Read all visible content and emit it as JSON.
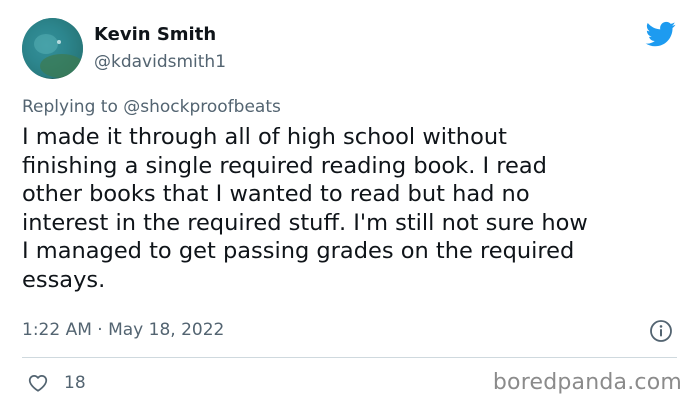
{
  "author": {
    "name": "Kevin Smith",
    "handle": "@kdavidsmith1"
  },
  "reply": {
    "prefix": "Replying to ",
    "mention": "@shockproofbeats"
  },
  "tweet": {
    "text": "I made it through all of high school without\nfinishing a single required reading book. I read\nother books that I wanted to read but had no\ninterest in the required stuff. I'm still not sure how\nI managed to get passing grades on the required\nessays."
  },
  "meta": {
    "timestamp": "1:22 AM · May 18, 2022"
  },
  "engagement": {
    "likes": "18"
  },
  "watermark": {
    "text": "boredpanda.com"
  },
  "icons": {
    "logo": "twitter-bird-icon",
    "info": "info-icon",
    "like": "heart-icon"
  },
  "colors": {
    "twitter_blue": "#1d9bf0",
    "text_primary": "#0f1419",
    "text_secondary": "#536471",
    "divider": "#cfd9de"
  }
}
